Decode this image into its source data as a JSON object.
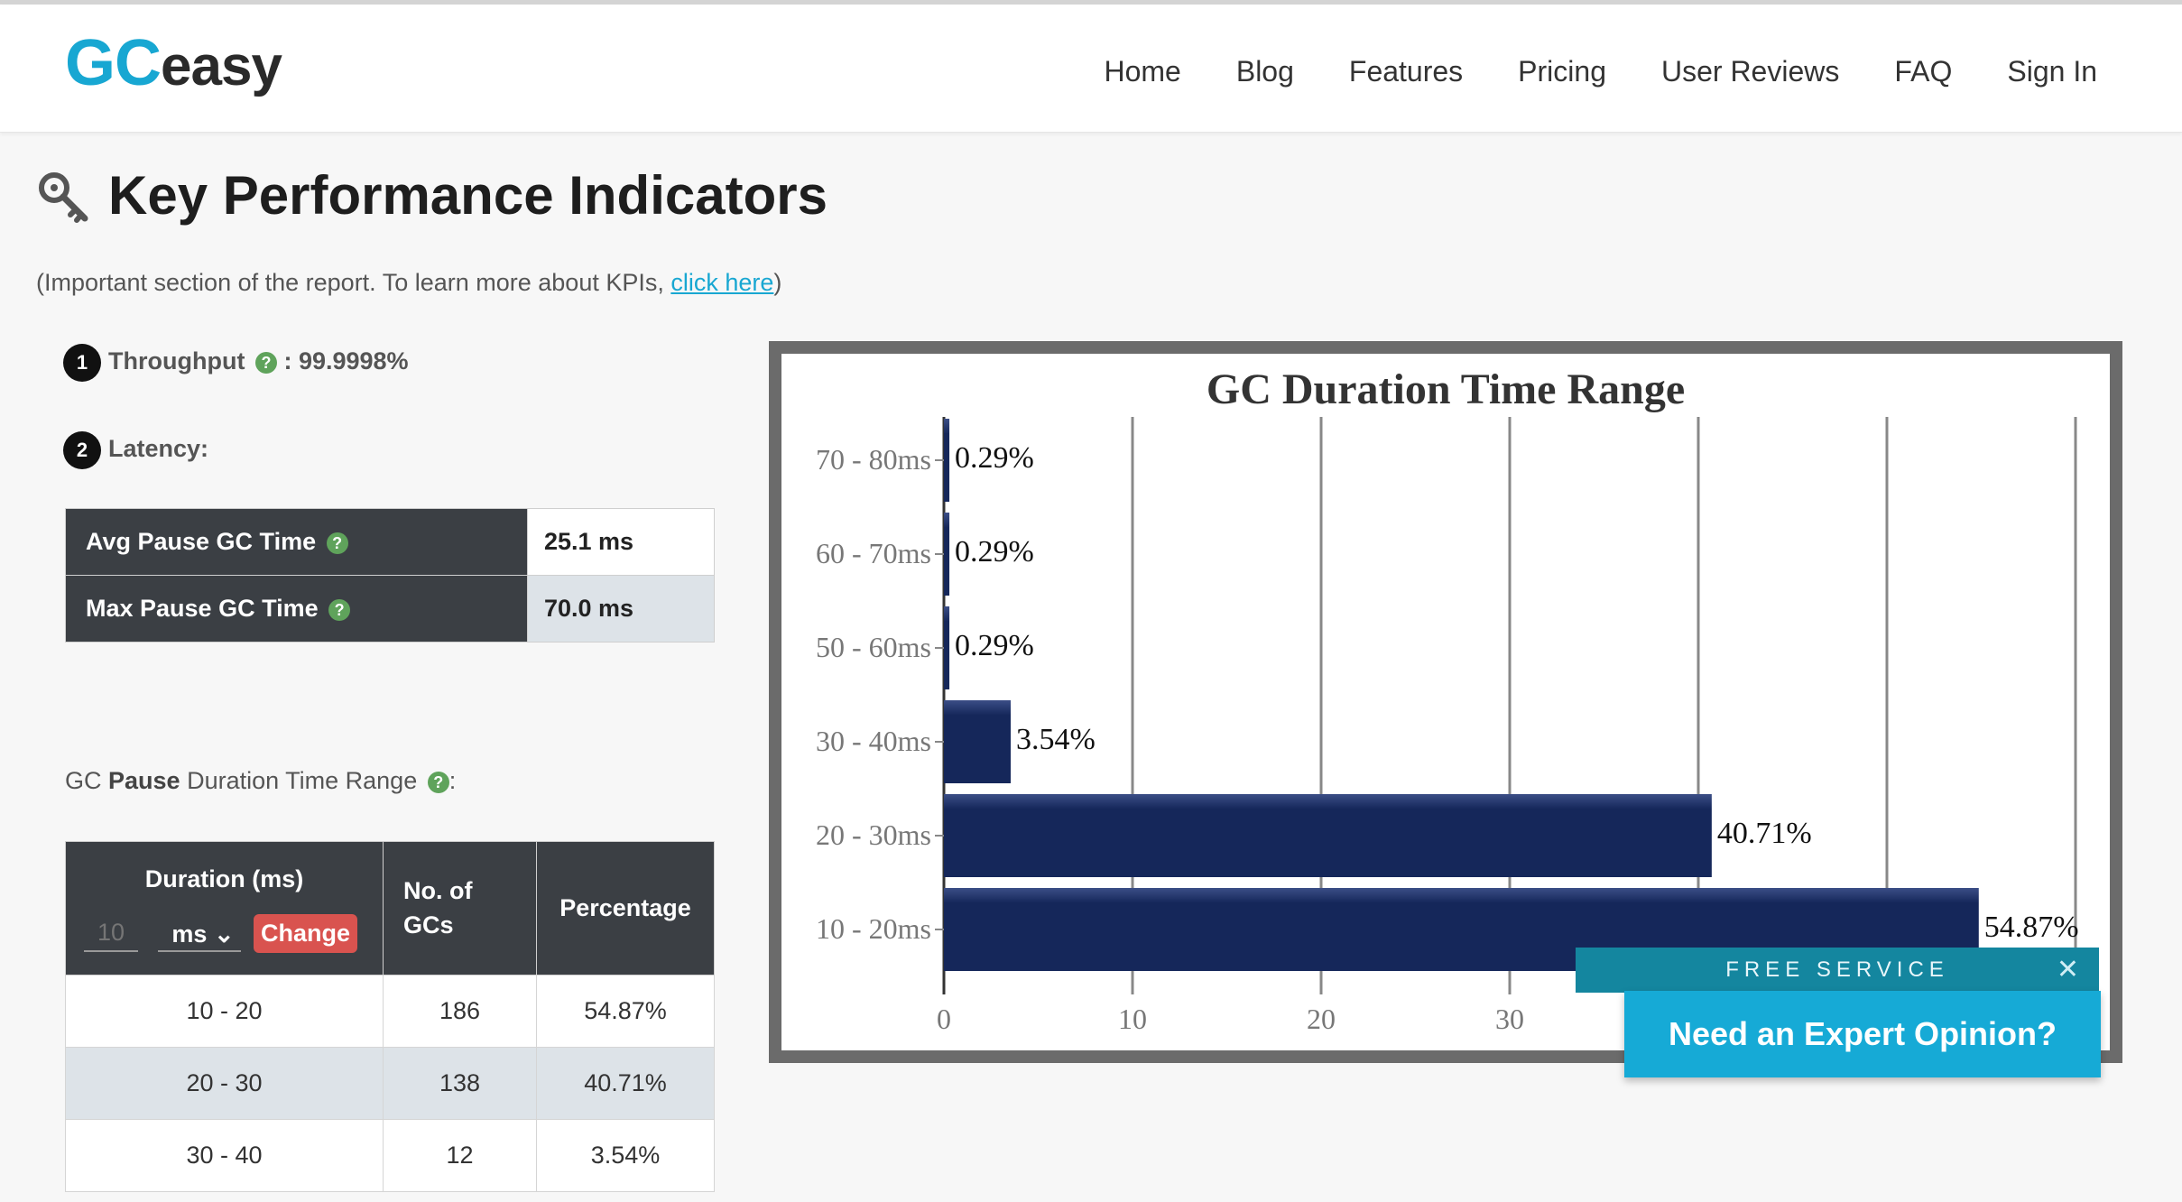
{
  "nav": {
    "logo_gc": "GC",
    "logo_easy": "easy",
    "items": [
      "Home",
      "Blog",
      "Features",
      "Pricing",
      "User Reviews",
      "FAQ",
      "Sign In"
    ]
  },
  "kpi": {
    "title": "Key Performance Indicators",
    "subtitle_prefix": "(Important section of the report. To learn more about KPIs, ",
    "subtitle_link": "click here",
    "subtitle_suffix": ")",
    "throughput_num": "1",
    "throughput_label": "Throughput",
    "throughput_value": " : 99.9998%",
    "latency_num": "2",
    "latency_label": "Latency:",
    "latency_rows": [
      {
        "key": "Avg Pause GC Time",
        "value": "25.1 ms"
      },
      {
        "key": "Max Pause GC Time",
        "value": "70.0 ms"
      }
    ]
  },
  "range_section": {
    "label_pre": "GC ",
    "label_bold": "Pause",
    "label_post": " Duration Time Range",
    "label_end": ":",
    "headers": {
      "duration": "Duration (ms)",
      "gcs_line1": "No. of",
      "gcs_line2": "GCs",
      "percentage": "Percentage"
    },
    "duration_input_placeholder": "10",
    "duration_unit": "ms",
    "change_label": "Change",
    "rows": [
      {
        "range": "10 - 20",
        "count": "186",
        "pct": "54.87%"
      },
      {
        "range": "20 - 30",
        "count": "138",
        "pct": "40.71%"
      },
      {
        "range": "30 - 40",
        "count": "12",
        "pct": "3.54%"
      }
    ]
  },
  "chart_data": {
    "type": "bar",
    "orientation": "horizontal",
    "title": "GC Duration Time Range",
    "categories": [
      "70 - 80ms",
      "60 - 70ms",
      "50 - 60ms",
      "30 - 40ms",
      "20 - 30ms",
      "10 - 20ms"
    ],
    "values": [
      0.29,
      0.29,
      0.29,
      3.54,
      40.71,
      54.87
    ],
    "data_labels": [
      "0.29%",
      "0.29%",
      "0.29%",
      "3.54%",
      "40.71%",
      "54.87%"
    ],
    "xticks": [
      0,
      10,
      20,
      30
    ],
    "xlim": [
      0,
      60
    ],
    "grid": true,
    "bar_color": "#15275a"
  },
  "promo": {
    "banner": "FREE SERVICE",
    "close": "✕",
    "button": "Need an Expert Opinion?"
  }
}
